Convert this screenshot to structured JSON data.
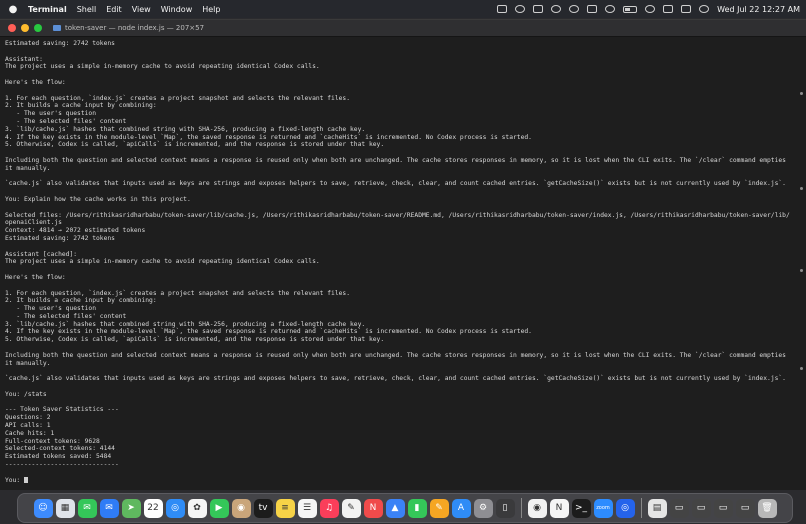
{
  "menubar": {
    "app": "Terminal",
    "menus": [
      "Shell",
      "Edit",
      "View",
      "Window",
      "Help"
    ],
    "clock": "Wed Jul 22  12:27 AM"
  },
  "window": {
    "title": "token-saver — node index.js — 207×57"
  },
  "terminal": {
    "lines": [
      "Estimated saving: 2742 tokens",
      "",
      "Assistant:",
      "The project uses a simple in-memory cache to avoid repeating identical Codex calls.",
      "",
      "Here's the flow:",
      "",
      "1. For each question, `index.js` creates a project snapshot and selects the relevant files.",
      "2. It builds a cache input by combining:",
      "   - The user's question",
      "   - The selected files' content",
      "3. `lib/cache.js` hashes that combined string with SHA-256, producing a fixed-length cache key.",
      "4. If the key exists in the module-level `Map`, the saved response is returned and `cacheHits` is incremented. No Codex process is started.",
      "5. Otherwise, Codex is called, `apiCalls` is incremented, and the response is stored under that key.",
      "",
      "Including both the question and selected context means a response is reused only when both are unchanged. The cache stores responses in memory, so it is lost when the CLI exits. The `/clear` command empties",
      "it manually.",
      "",
      "`cache.js` also validates that inputs used as keys are strings and exposes helpers to save, retrieve, check, clear, and count cached entries. `getCacheSize()` exists but is not currently used by `index.js`.",
      "",
      "You: Explain how the cache works in this project.",
      "",
      "Selected files: /Users/rithikasridharbabu/token-saver/lib/cache.js, /Users/rithikasridharbabu/token-saver/README.md, /Users/rithikasridharbabu/token-saver/index.js, /Users/rithikasridharbabu/token-saver/lib/",
      "openaiClient.js",
      "Context: 4814 → 2072 estimated tokens",
      "Estimated saving: 2742 tokens",
      "",
      "Assistant [cached]:",
      "The project uses a simple in-memory cache to avoid repeating identical Codex calls.",
      "",
      "Here's the flow:",
      "",
      "1. For each question, `index.js` creates a project snapshot and selects the relevant files.",
      "2. It builds a cache input by combining:",
      "   - The user's question",
      "   - The selected files' content",
      "3. `lib/cache.js` hashes that combined string with SHA-256, producing a fixed-length cache key.",
      "4. If the key exists in the module-level `Map`, the saved response is returned and `cacheHits` is incremented. No Codex process is started.",
      "5. Otherwise, Codex is called, `apiCalls` is incremented, and the response is stored under that key.",
      "",
      "Including both the question and selected context means a response is reused only when both are unchanged. The cache stores responses in memory, so it is lost when the CLI exits. The `/clear` command empties",
      "it manually.",
      "",
      "`cache.js` also validates that inputs used as keys are strings and exposes helpers to save, retrieve, check, clear, and count cached entries. `getCacheSize()` exists but is not currently used by `index.js`.",
      "",
      "You: /stats",
      "",
      "--- Token Saver Statistics ---",
      "Questions: 2",
      "API calls: 1",
      "Cache hits: 1",
      "Full-context tokens: 9628",
      "Selected-context tokens: 4144",
      "Estimated tokens saved: 5484",
      "------------------------------",
      "",
      "You: "
    ]
  },
  "dock": {
    "apps": [
      {
        "name": "finder",
        "color": "#3d8bfd",
        "glyph": "☺"
      },
      {
        "name": "launchpad",
        "color": "#dfe3ea",
        "glyph": "▦"
      },
      {
        "name": "messages",
        "color": "#34c759",
        "glyph": "✉"
      },
      {
        "name": "mail",
        "color": "#2f7cf6",
        "glyph": "✉"
      },
      {
        "name": "maps",
        "color": "#5fb85f",
        "glyph": "➤"
      },
      {
        "name": "calendar",
        "color": "#ffffff",
        "glyph": "22"
      },
      {
        "name": "safari",
        "color": "#2f8cf6",
        "glyph": "◎"
      },
      {
        "name": "photos",
        "color": "#f5f5f5",
        "glyph": "✿"
      },
      {
        "name": "facetime",
        "color": "#34c759",
        "glyph": "▶"
      },
      {
        "name": "contacts",
        "color": "#c9a57a",
        "glyph": "◉"
      },
      {
        "name": "tv",
        "color": "#1c1c1c",
        "glyph": "tv"
      },
      {
        "name": "notes",
        "color": "#f7d347",
        "glyph": "≡"
      },
      {
        "name": "reminders",
        "color": "#f5f5f5",
        "glyph": "☰"
      },
      {
        "name": "music",
        "color": "#fa3e5a",
        "glyph": "♫"
      },
      {
        "name": "freeform",
        "color": "#f2f2f2",
        "glyph": "✎"
      },
      {
        "name": "news",
        "color": "#f04b4b",
        "glyph": "N"
      },
      {
        "name": "keynote",
        "color": "#3b82f6",
        "glyph": "▲"
      },
      {
        "name": "numbers",
        "color": "#35c759",
        "glyph": "▮"
      },
      {
        "name": "pages",
        "color": "#f5a623",
        "glyph": "✎"
      },
      {
        "name": "app-store",
        "color": "#2f8cf6",
        "glyph": "A"
      },
      {
        "name": "system-settings",
        "color": "#8e8e93",
        "glyph": "⚙"
      },
      {
        "name": "iphone-mirroring",
        "color": "#3a3a3c",
        "glyph": "▯"
      },
      {
        "name": "chrome",
        "color": "#f2f2f2",
        "glyph": "◉"
      },
      {
        "name": "notion",
        "color": "#f5f5f5",
        "glyph": "N"
      },
      {
        "name": "terminal",
        "color": "#1c1c1c",
        "glyph": ">_"
      },
      {
        "name": "zoom",
        "color": "#2d8cff",
        "glyph": "zoom"
      },
      {
        "name": "proxyman",
        "color": "#2563eb",
        "glyph": "◎"
      },
      {
        "name": "document",
        "color": "#e5e5e5",
        "glyph": "▤"
      },
      {
        "name": "screenshot-1",
        "color": "#444",
        "glyph": "▭"
      },
      {
        "name": "screenshot-2",
        "color": "#444",
        "glyph": "▭"
      },
      {
        "name": "screenshot-3",
        "color": "#444",
        "glyph": "▭"
      },
      {
        "name": "screenshot-4",
        "color": "#444",
        "glyph": "▭"
      },
      {
        "name": "trash",
        "color": "#b8b8b8",
        "glyph": "🗑"
      }
    ]
  },
  "colors": {
    "terminal_bg": "#1e1e1e",
    "terminal_fg": "#d8d8d8"
  }
}
